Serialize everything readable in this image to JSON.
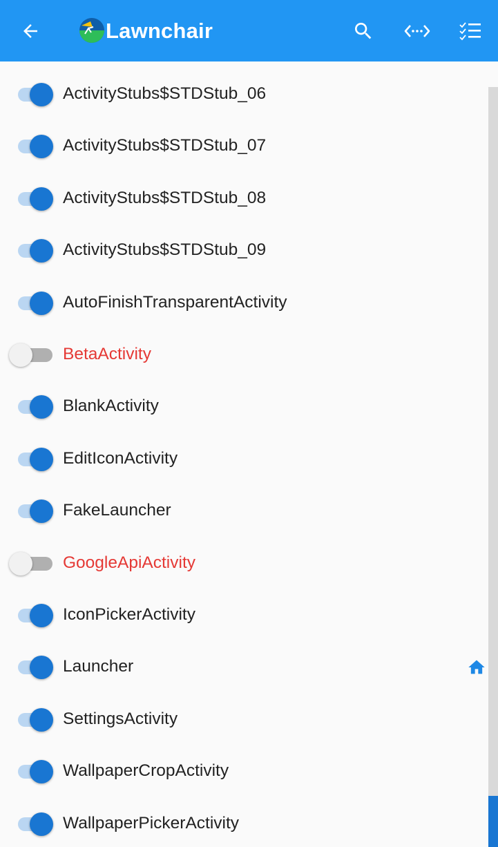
{
  "appbar": {
    "title": "Lawnchair",
    "back_icon": "arrow-back-icon",
    "actions": [
      "search-icon",
      "code-icon",
      "checklist-icon"
    ]
  },
  "colors": {
    "appbar": "#2196f3",
    "switch_on": "#1976d2",
    "disabled_text": "#e53935"
  },
  "items": [
    {
      "label": "ActivityStubs$STDStub_06",
      "enabled": true
    },
    {
      "label": "ActivityStubs$STDStub_07",
      "enabled": true
    },
    {
      "label": "ActivityStubs$STDStub_08",
      "enabled": true
    },
    {
      "label": "ActivityStubs$STDStub_09",
      "enabled": true
    },
    {
      "label": "AutoFinishTransparentActivity",
      "enabled": true
    },
    {
      "label": "BetaActivity",
      "enabled": false
    },
    {
      "label": "BlankActivity",
      "enabled": true
    },
    {
      "label": "EditIconActivity",
      "enabled": true
    },
    {
      "label": "FakeLauncher",
      "enabled": true
    },
    {
      "label": "GoogleApiActivity",
      "enabled": false
    },
    {
      "label": "IconPickerActivity",
      "enabled": true
    },
    {
      "label": "Launcher",
      "enabled": true,
      "icon": "home-icon"
    },
    {
      "label": "SettingsActivity",
      "enabled": true
    },
    {
      "label": "WallpaperCropActivity",
      "enabled": true
    },
    {
      "label": "WallpaperPickerActivity",
      "enabled": true
    }
  ]
}
